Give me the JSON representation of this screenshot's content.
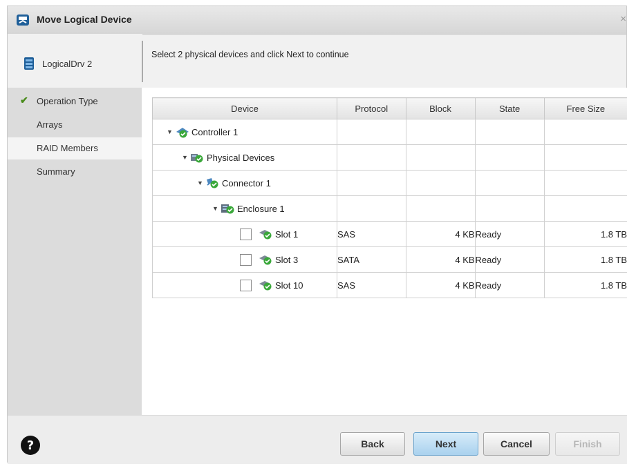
{
  "window": {
    "title": "Move Logical Device",
    "close_glyph": "×"
  },
  "device": {
    "name": "LogicalDrv 2"
  },
  "instruction": "Select 2 physical devices and click Next to continue",
  "sidebar": {
    "items": [
      {
        "label": "Operation Type",
        "completed": true,
        "active": false
      },
      {
        "label": "Arrays",
        "completed": false,
        "active": false
      },
      {
        "label": "RAID Members",
        "completed": false,
        "active": true
      },
      {
        "label": "Summary",
        "completed": false,
        "active": false
      }
    ]
  },
  "table": {
    "headers": [
      "Device",
      "Protocol",
      "Block",
      "State",
      "Free Size"
    ],
    "rows": [
      {
        "device": "Controller 1",
        "level": 0,
        "icon": "controller-icon",
        "expandable": true
      },
      {
        "device": "Physical Devices",
        "level": 1,
        "icon": "physical-devices-icon",
        "expandable": true
      },
      {
        "device": "Connector 1",
        "level": 2,
        "icon": "connector-icon",
        "expandable": true
      },
      {
        "device": "Enclosure 1",
        "level": 3,
        "icon": "enclosure-icon",
        "expandable": true
      },
      {
        "device": "Slot 1",
        "protocol": "SAS",
        "block": "4 KB",
        "state": "Ready",
        "free_size": "1.8 TB",
        "icon": "drive-icon",
        "checked": false
      },
      {
        "device": "Slot 3",
        "protocol": "SATA",
        "block": "4 KB",
        "state": "Ready",
        "free_size": "1.8 TB",
        "icon": "drive-icon",
        "checked": false
      },
      {
        "device": "Slot 10",
        "protocol": "SAS",
        "block": "4 KB",
        "state": "Ready",
        "free_size": "1.8 TB",
        "icon": "drive-icon",
        "checked": false
      }
    ]
  },
  "buttons": {
    "back": "Back",
    "next": "Next",
    "cancel": "Cancel",
    "finish": "Finish"
  },
  "colors": {
    "accent": "#a9d1ee",
    "check_green": "#4a8c1c",
    "status_ok": "#3aa83a"
  }
}
